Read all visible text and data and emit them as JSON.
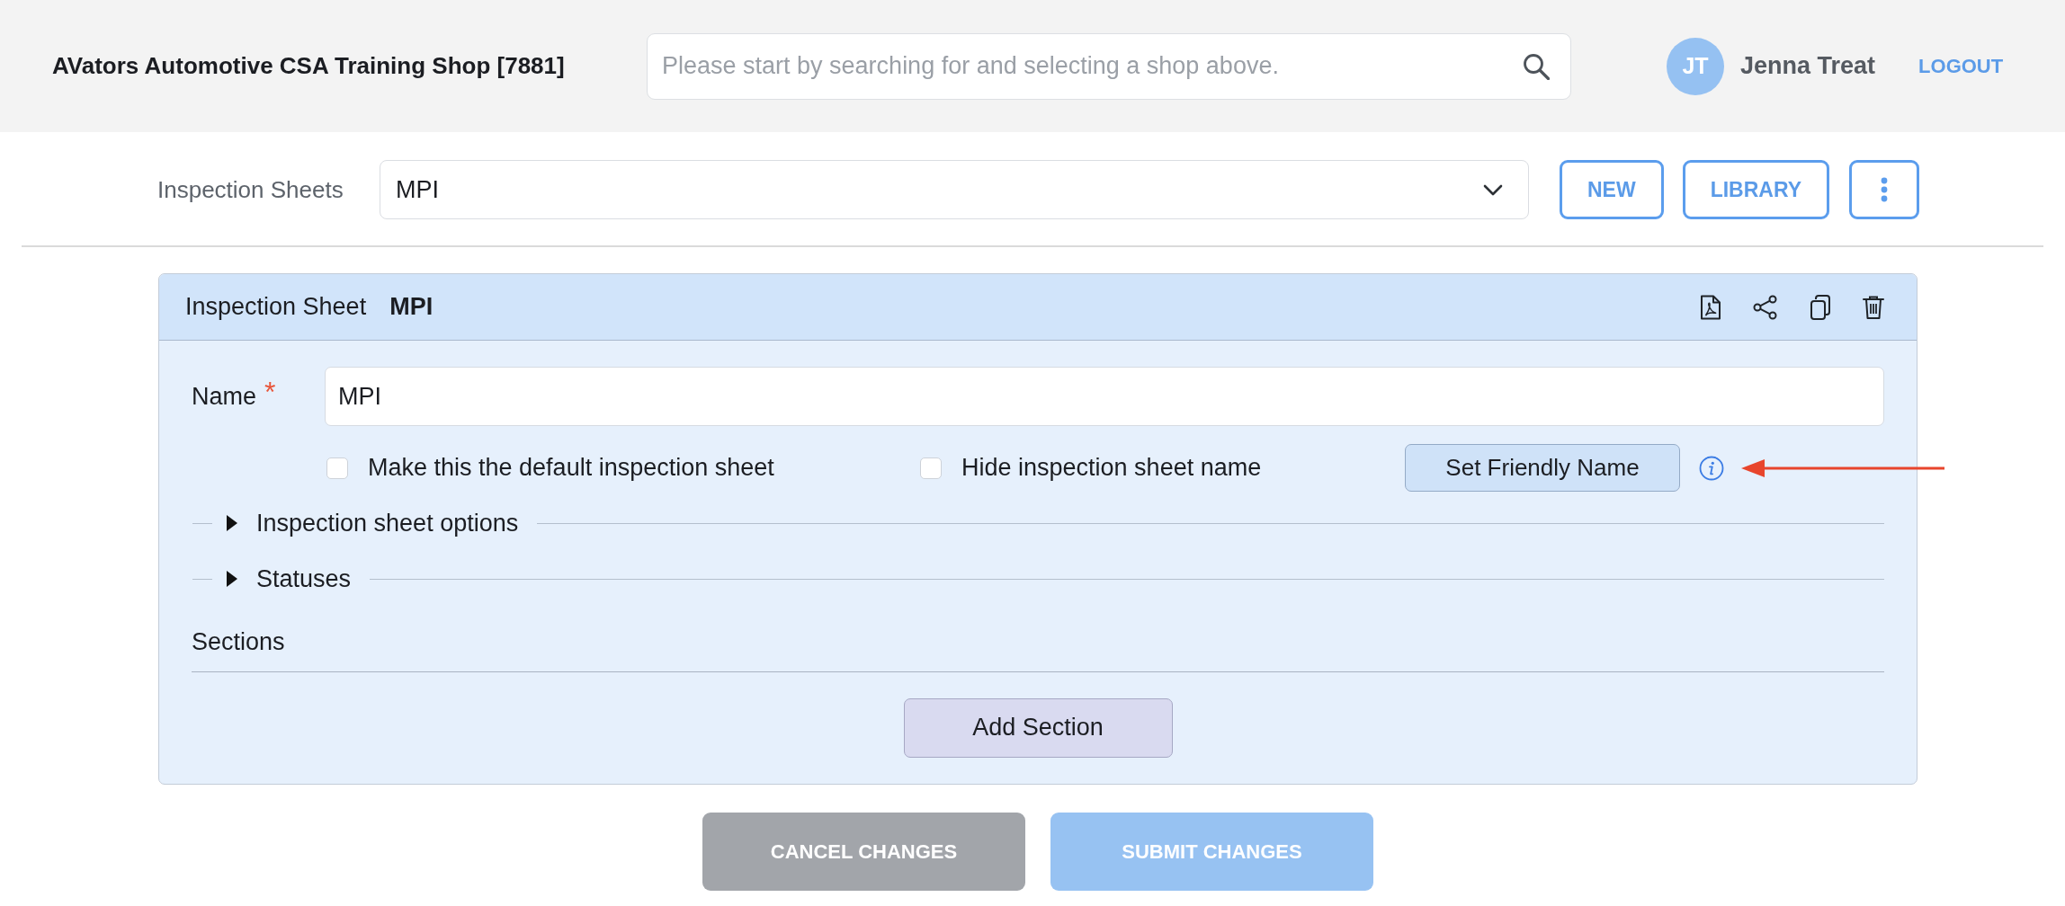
{
  "header": {
    "shop_name": "AVators Automotive CSA Training Shop [7881]",
    "search": {
      "placeholder": "Please start by searching for and selecting a shop above."
    },
    "user": {
      "initials": "JT",
      "name": "Jenna Treat"
    },
    "logout": "LOGOUT"
  },
  "toolbar": {
    "label": "Inspection Sheets",
    "select": {
      "value": "MPI"
    },
    "buttons": [
      "NEW",
      "LIBRARY"
    ]
  },
  "card": {
    "title": "Inspection Sheet",
    "sheet_name": "MPI"
  },
  "form": {
    "name_label": "Name",
    "required_mark": "*",
    "name_value": "MPI",
    "checkboxes": [
      {
        "label": "Make this the default inspection sheet",
        "checked": false
      },
      {
        "label": "Hide inspection sheet name",
        "checked": false
      }
    ],
    "friendly_name_button": "Set Friendly Name",
    "collapsibles": [
      {
        "label": "Inspection sheet options",
        "expanded": false
      },
      {
        "label": "Statuses",
        "expanded": false
      }
    ],
    "sections_label": "Sections",
    "add_section_button": "Add Section"
  },
  "footer_buttons": [
    {
      "kind": "cancel",
      "label": "CANCEL CHANGES"
    },
    {
      "kind": "submit",
      "label": "SUBMIT CHANGES"
    }
  ]
}
